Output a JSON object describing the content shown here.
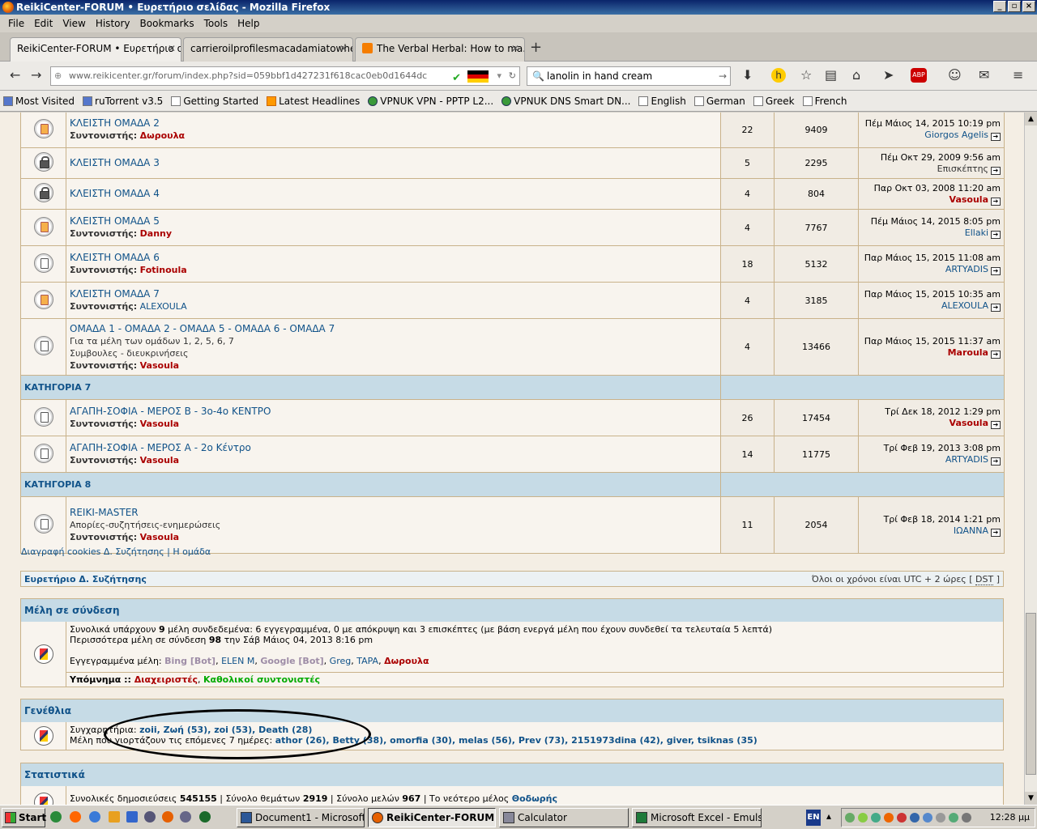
{
  "window": {
    "title": "ReikiCenter-FORUM • Ευρετήριο σελίδας - Mozilla Firefox"
  },
  "menu": [
    "File",
    "Edit",
    "View",
    "History",
    "Bookmarks",
    "Tools",
    "Help"
  ],
  "tabs": [
    {
      "label": "ReikiCenter-FORUM • Ευρετήριο σ...",
      "active": true
    },
    {
      "label": "carrieroilprofilesmacadamiatowhea...",
      "active": false
    },
    {
      "label": "The Verbal Herbal: How to ma...",
      "active": false
    }
  ],
  "url": "www.reikicenter.gr/forum/index.php?sid=059bbf1d427231f618cac0eb0d1644dc",
  "search": {
    "value": "lanolin in hand cream"
  },
  "bookmarks": [
    "Most Visited",
    "ruTorrent v3.5",
    "Getting Started",
    "Latest Headlines",
    "VPNUK VPN - PPTP L2...",
    "VPNUK DNS Smart DN...",
    "English",
    "German",
    "Greek",
    "French"
  ],
  "forum_rows": [
    {
      "name": "ΚΛΕΙΣΤΗ ΟΜΑΔΑ 2",
      "desc": [],
      "mod_label": "Συντονιστής:",
      "mod": "Δωρουλα",
      "mod_class": "admin",
      "topics": "22",
      "posts": "9409",
      "last_date": "Πέμ Μάιος 14, 2015 10:19 pm",
      "last_user": "Giorgos Agelis",
      "last_class": "user",
      "icon": "orange"
    },
    {
      "name": "ΚΛΕΙΣΤΗ ΟΜΑΔΑ 3",
      "desc": [],
      "mod_label": "",
      "mod": "",
      "mod_class": "",
      "topics": "5",
      "posts": "2295",
      "last_date": "Πέμ Οκτ 29, 2009 9:56 am",
      "last_user": "Επισκέπτης",
      "last_class": "guest",
      "icon": "lock"
    },
    {
      "name": "ΚΛΕΙΣΤΗ ΟΜΑΔΑ 4",
      "desc": [],
      "mod_label": "",
      "mod": "",
      "mod_class": "",
      "topics": "4",
      "posts": "804",
      "last_date": "Παρ Οκτ 03, 2008 11:20 am",
      "last_user": "Vasoula",
      "last_class": "admin",
      "icon": "lock"
    },
    {
      "name": "ΚΛΕΙΣΤΗ ΟΜΑΔΑ 5",
      "desc": [],
      "mod_label": "Συντονιστής:",
      "mod": "Danny",
      "mod_class": "admin",
      "topics": "4",
      "posts": "7767",
      "last_date": "Πέμ Μάιος 14, 2015 8:05 pm",
      "last_user": "Ellaki",
      "last_class": "user",
      "icon": "orange"
    },
    {
      "name": "ΚΛΕΙΣΤΗ ΟΜΑΔΑ 6",
      "desc": [],
      "mod_label": "Συντονιστής:",
      "mod": "Fotinoula",
      "mod_class": "admin",
      "topics": "18",
      "posts": "5132",
      "last_date": "Παρ Μάιος 15, 2015 11:08 am",
      "last_user": "ARTYADIS",
      "last_class": "user",
      "icon": "plain"
    },
    {
      "name": "ΚΛΕΙΣΤΗ ΟΜΑΔΑ 7",
      "desc": [],
      "mod_label": "Συντονιστής:",
      "mod": "ALEXOULA",
      "mod_class": "user",
      "topics": "4",
      "posts": "3185",
      "last_date": "Παρ Μάιος 15, 2015 10:35 am",
      "last_user": "ALEXOULA",
      "last_class": "user",
      "icon": "orange"
    },
    {
      "name": "ΟΜΑΔΑ 1 - ΟΜΑΔΑ 2 - ΟΜΑΔΑ 5 - ΟΜΑΔΑ 6 - ΟΜΑΔΑ 7",
      "desc": [
        "Για τα μέλη των ομάδων 1, 2, 5, 6, 7",
        "Συμβουλες - διευκρινήσεις"
      ],
      "mod_label": "Συντονιστής:",
      "mod": "Vasoula",
      "mod_class": "admin",
      "topics": "4",
      "posts": "13466",
      "last_date": "Παρ Μάιος 15, 2015 11:37 am",
      "last_user": "Maroula",
      "last_class": "admin",
      "icon": "plain"
    },
    {
      "category": "ΚΑΤΗΓΟΡΙΑ 7"
    },
    {
      "name": "ΑΓΑΠΗ-ΣΟΦΙΑ - ΜΕΡΟΣ Β - 3ο-4ο ΚΕΝΤΡΟ",
      "desc": [],
      "mod_label": "Συντονιστής:",
      "mod": "Vasoula",
      "mod_class": "admin",
      "topics": "26",
      "posts": "17454",
      "last_date": "Τρί Δεκ 18, 2012 1:29 pm",
      "last_user": "Vasoula",
      "last_class": "admin",
      "icon": "plain"
    },
    {
      "name": "ΑΓΑΠΗ-ΣΟΦΙΑ - ΜΕΡΟΣ Α - 2ο Κέντρο",
      "desc": [],
      "mod_label": "Συντονιστής:",
      "mod": "Vasoula",
      "mod_class": "admin",
      "topics": "14",
      "posts": "11775",
      "last_date": "Τρί Φεβ 19, 2013 3:08 pm",
      "last_user": "ARTYADIS",
      "last_class": "user",
      "icon": "plain"
    },
    {
      "category": "ΚΑΤΗΓΟΡΙΑ 8"
    },
    {
      "name": "REIKI-MASTER",
      "desc": [
        "Απορίες-συζητήσεις-ενημερώσεις"
      ],
      "mod_label": "Συντονιστής:",
      "mod": "Vasoula",
      "mod_class": "admin",
      "topics": "11",
      "posts": "2054",
      "last_date": "Τρί Φεβ 18, 2014 1:21 pm",
      "last_user": "ΙΩΑΝΝΑ",
      "last_class": "user",
      "icon": "plain"
    }
  ],
  "footer_links": {
    "cookies": "Διαγραφή cookies Δ. Συζήτησης",
    "sep": " | ",
    "team": "Η ομάδα"
  },
  "index_bar": {
    "left": "Ευρετήριο Δ. Συζήτησης",
    "right_prefix": "Όλοι οι χρόνοι είναι UTC + 2 ώρες [ ",
    "dst": "DST",
    "right_suffix": " ]"
  },
  "online": {
    "title": "Μέλη σε σύνδεση",
    "line1_a": "Συνολικά υπάρχουν ",
    "line1_n": "9",
    "line1_b": " μέλη συνδεδεμένα: 6 εγγεγραμμένα, 0 με απόκρυψη και 3 επισκέπτες (με βάση ενεργά μέλη που έχουν συνδεθεί τα τελευταία 5 λεπτά)",
    "line2_a": "Περισσότερα μέλη σε σύνδεση ",
    "line2_n": "98",
    "line2_b": " την Σάβ Μάιος 04, 2013 8:16 pm",
    "registered_label": "Εγγεγραμμένα μέλη: ",
    "registered": [
      {
        "name": "Bing [Bot]",
        "cls": "gray-bot"
      },
      {
        "name": "ELEN M",
        "cls": "user"
      },
      {
        "name": "Google [Bot]",
        "cls": "gray-bot"
      },
      {
        "name": "Greg",
        "cls": "user"
      },
      {
        "name": "TAPA",
        "cls": "user"
      },
      {
        "name": "Δωρουλα",
        "cls": "admin"
      }
    ],
    "legend_label": "Υπόμνημα :: ",
    "legend_admin": "Διαχειριστές",
    "legend_mod": "Καθολικοί συντονιστές"
  },
  "birthdays": {
    "title": "Γενέθλια",
    "today_label": "Συγχαρητήρια: ",
    "today": "zoii, Ζωή (53), zoi (53), Death (28)",
    "upcoming_label": "Μέλη που γιορτάζουν τις επόμενες 7 ημέρες: ",
    "upcoming": "athor (26), Betty (38), omorfia (30), melas (56), Prev (73), 2151973dina (42), giver, tsiknas (35)"
  },
  "stats": {
    "title": "Στατιστικά",
    "posts_label": "Συνολικές δημοσιεύσεις ",
    "posts": "545155",
    "topics_label": " | Σύνολο θεμάτων ",
    "topics": "2919",
    "members_label": " | Σύνολο μελών ",
    "members": "967",
    "newest_label": " | Το νεότερο μέλος ",
    "newest": "Θοδωρής"
  },
  "taskbar": {
    "start": "Start",
    "buttons": [
      {
        "label": "Document1 - Microsoft ...",
        "active": false,
        "color": "#2b5797"
      },
      {
        "label": "ReikiCenter-FORUM •...",
        "active": true,
        "color": "#e66000"
      },
      {
        "label": "Calculator",
        "active": false,
        "color": "#889"
      },
      {
        "label": "Microsoft Excel - Emulsifi...",
        "active": false,
        "color": "#1f7a3a"
      }
    ],
    "lang": "EN",
    "clock": "12:28 μμ"
  },
  "colors": {
    "accent": "#105289",
    "admin": "#aa0000",
    "header_bg": "#c6dbe6"
  }
}
